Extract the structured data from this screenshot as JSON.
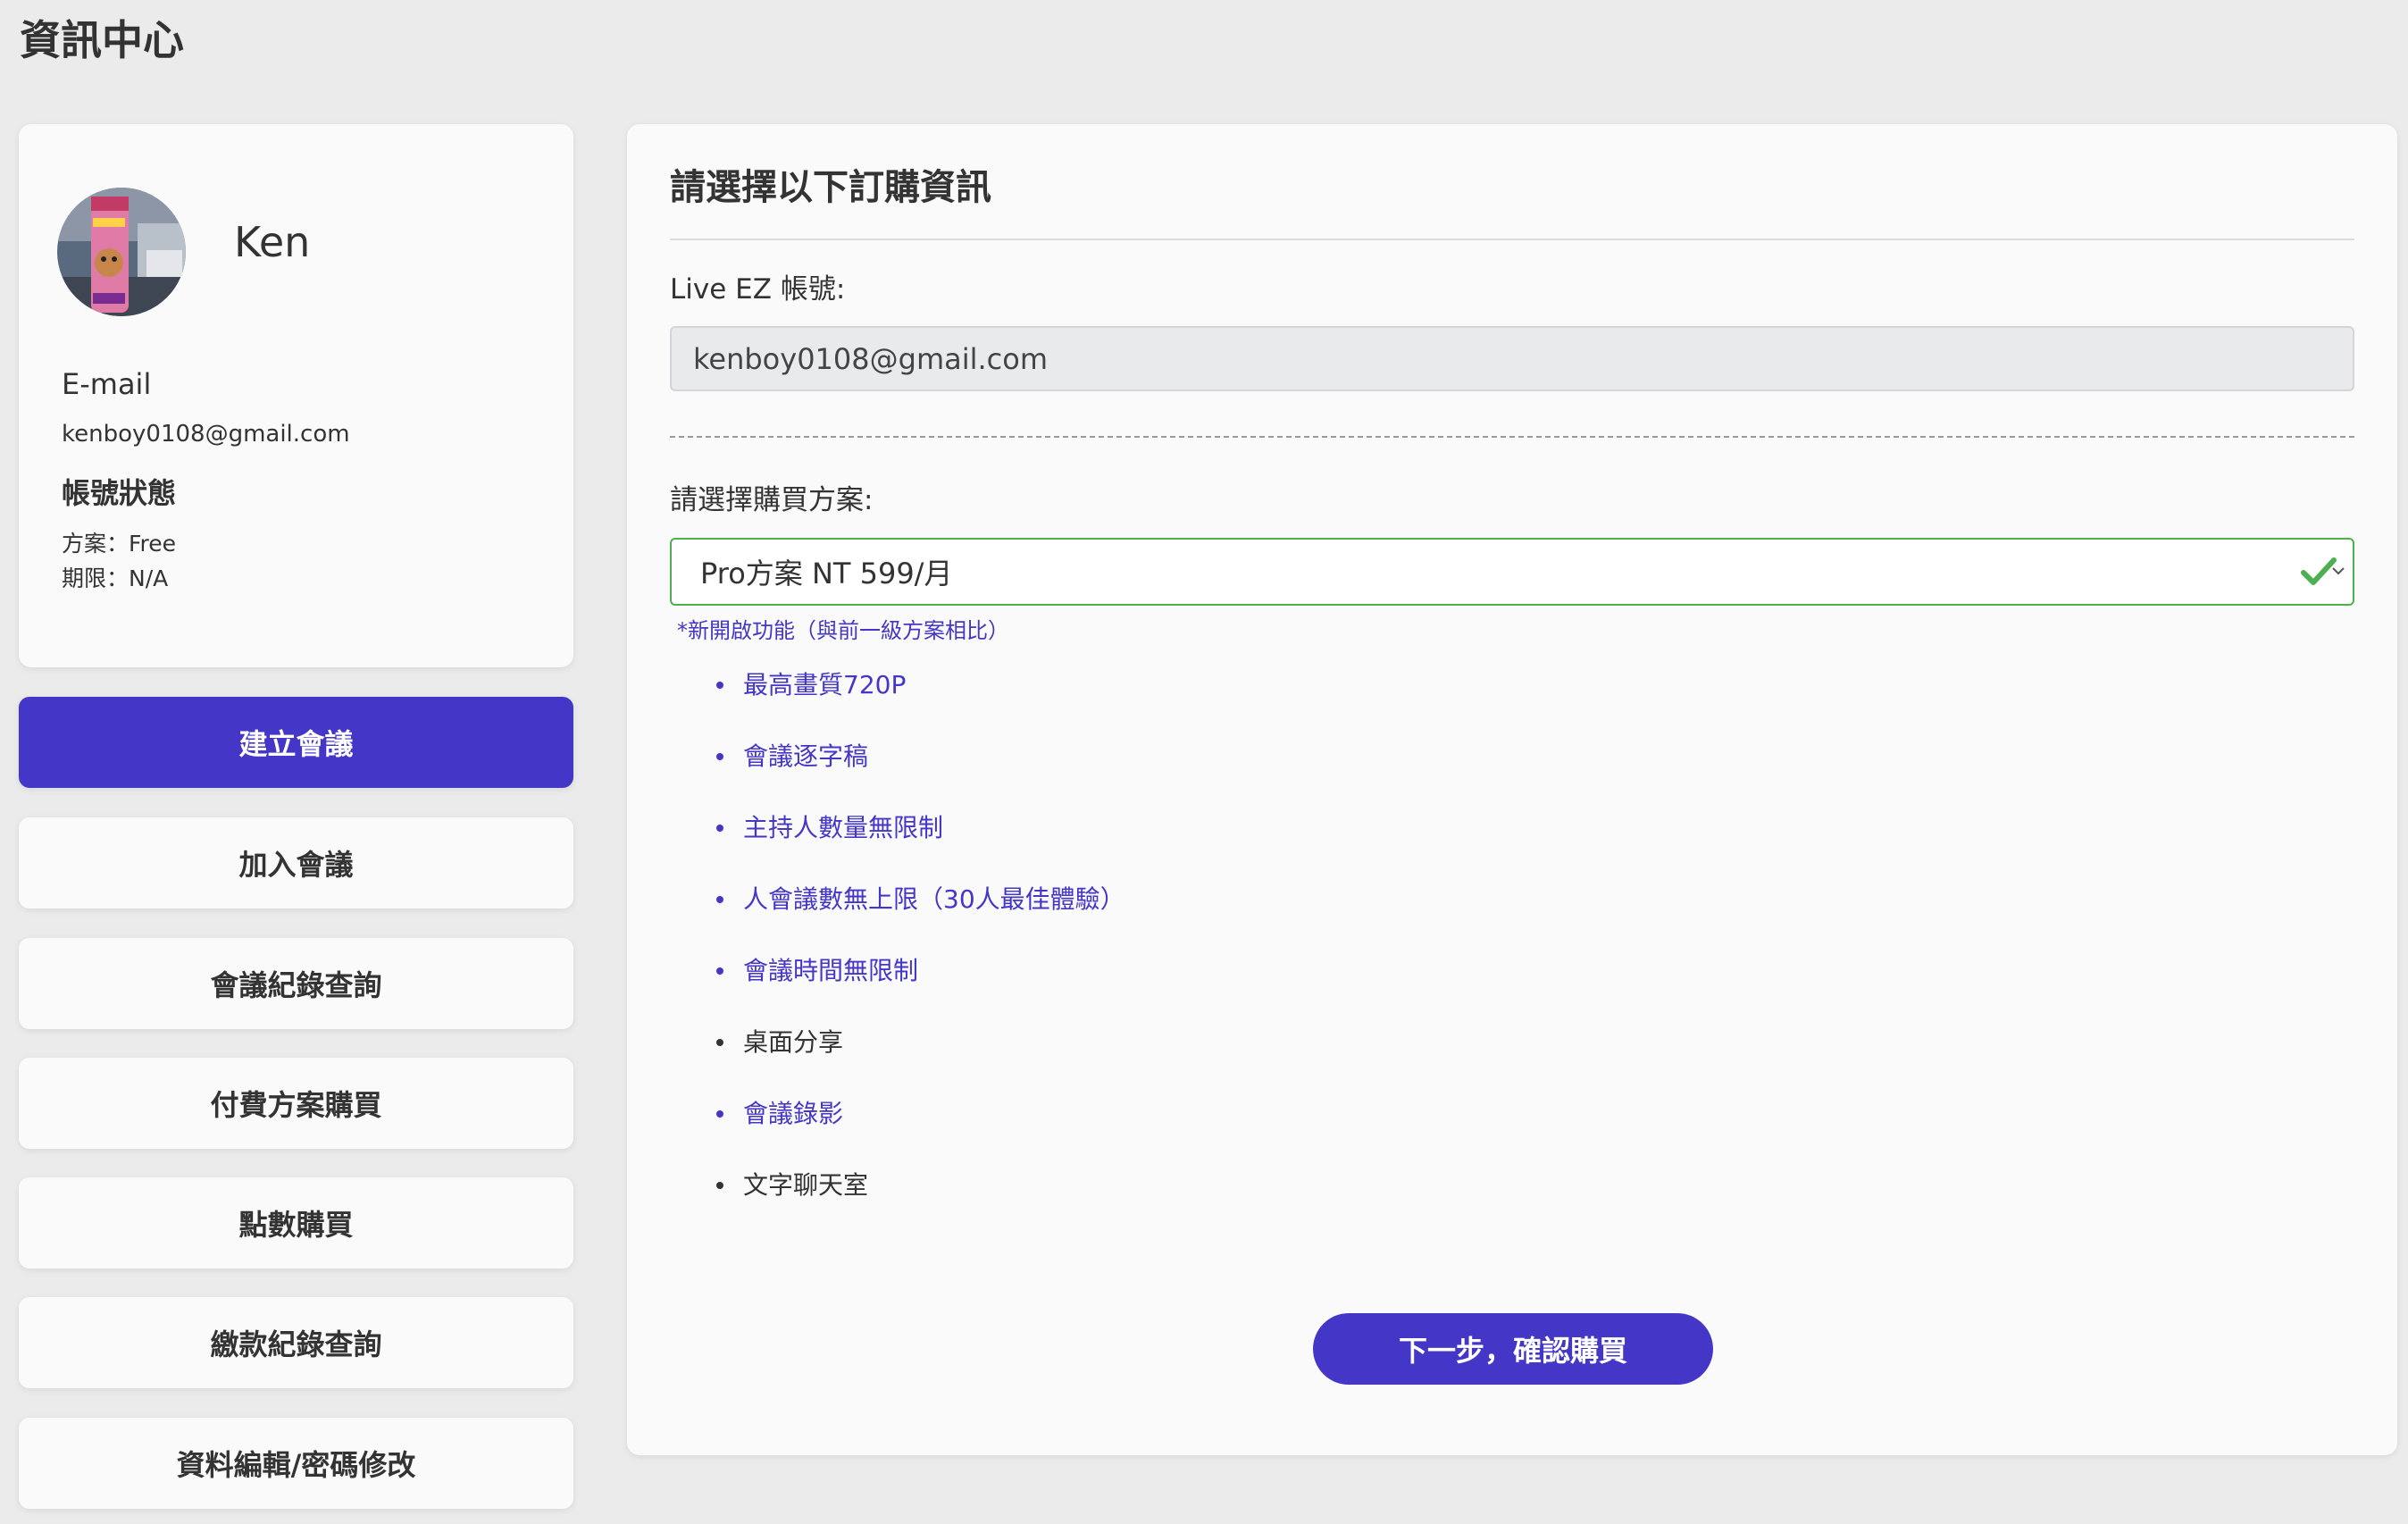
{
  "page": {
    "title": "資訊中心"
  },
  "profile": {
    "name": "Ken",
    "email_label": "E-mail",
    "email": "kenboy0108@gmail.com",
    "status_label": "帳號狀態",
    "plan_line": "方案：Free",
    "expire_line": "期限：N/A"
  },
  "menu": [
    {
      "label": "建立會議",
      "active": true
    },
    {
      "label": "加入會議",
      "active": false
    },
    {
      "label": "會議紀錄查詢",
      "active": false
    },
    {
      "label": "付費方案購買",
      "active": false
    },
    {
      "label": "點數購買",
      "active": false
    },
    {
      "label": "繳款紀錄查詢",
      "active": false
    },
    {
      "label": "資料編輯/密碼修改",
      "active": false
    }
  ],
  "order": {
    "heading": "請選擇以下訂購資訊",
    "account_label": "Live EZ 帳號:",
    "account_value": "kenboy0108@gmail.com",
    "plan_label": "請選擇購買方案:",
    "plan_selected": "Pro方案 NT 599/月",
    "plan_note": "*新開啟功能（與前一級方案相比）",
    "features": [
      {
        "label": "最高畫質720P",
        "new": true
      },
      {
        "label": "會議逐字稿",
        "new": true
      },
      {
        "label": "主持人數量無限制",
        "new": true
      },
      {
        "label": "人會議數無上限（30人最佳體驗）",
        "new": true
      },
      {
        "label": "會議時間無限制",
        "new": true
      },
      {
        "label": "桌面分享",
        "new": false
      },
      {
        "label": "會議錄影",
        "new": true
      },
      {
        "label": "文字聊天室",
        "new": false
      }
    ],
    "next_button": "下一步，確認購買"
  },
  "colors": {
    "accent": "#4437c8",
    "valid": "#4caf50",
    "background": "#ebebeb",
    "card": "#fafafa"
  },
  "icons": {
    "avatar": "avatar-photo",
    "select_valid": "check-icon",
    "select_arrow": "chevron-down-icon"
  }
}
